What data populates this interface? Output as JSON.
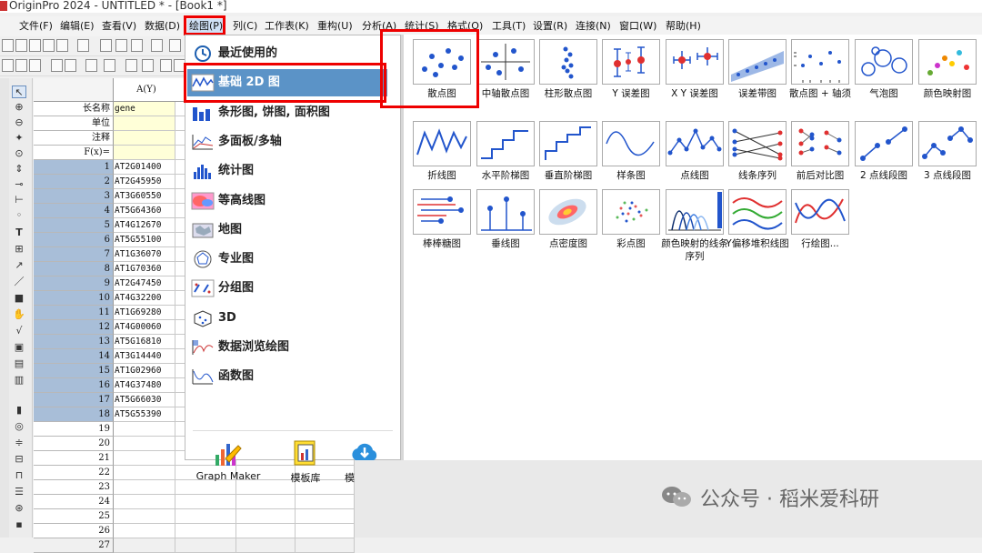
{
  "window": {
    "title": "OriginPro 2024 - UNTITLED * - [Book1 *]"
  },
  "menubar": [
    {
      "label": "文件(F)"
    },
    {
      "label": "编辑(E)"
    },
    {
      "label": "查看(V)"
    },
    {
      "label": "数据(D)"
    },
    {
      "label": "绘图(P)"
    },
    {
      "label": "列(C)"
    },
    {
      "label": "工作表(K)"
    },
    {
      "label": "重构(U)"
    },
    {
      "label": "分析(A)"
    },
    {
      "label": "统计(S)"
    },
    {
      "label": "格式(O)"
    },
    {
      "label": "工具(T)"
    },
    {
      "label": "设置(R)"
    },
    {
      "label": "连接(N)"
    },
    {
      "label": "窗口(W)"
    },
    {
      "label": "帮助(H)"
    }
  ],
  "worksheet": {
    "column_header": "A(Y)",
    "meta_rows": [
      {
        "label": "长名称",
        "value": "gene"
      },
      {
        "label": "单位",
        "value": ""
      },
      {
        "label": "注释",
        "value": ""
      },
      {
        "label": "F(x)=",
        "value": ""
      }
    ],
    "rows": [
      {
        "n": "1",
        "v": "AT2G01400"
      },
      {
        "n": "2",
        "v": "AT2G45950"
      },
      {
        "n": "3",
        "v": "AT3G60550"
      },
      {
        "n": "4",
        "v": "AT5G64360"
      },
      {
        "n": "5",
        "v": "AT4G12670"
      },
      {
        "n": "6",
        "v": "AT5G55100"
      },
      {
        "n": "7",
        "v": "AT1G36070"
      },
      {
        "n": "8",
        "v": "AT1G70360"
      },
      {
        "n": "9",
        "v": "AT2G47450"
      },
      {
        "n": "10",
        "v": "AT4G32200"
      },
      {
        "n": "11",
        "v": "AT1G69280"
      },
      {
        "n": "12",
        "v": "AT4G00060"
      },
      {
        "n": "13",
        "v": "AT5G16810"
      },
      {
        "n": "14",
        "v": "AT3G14440"
      },
      {
        "n": "15",
        "v": "AT1G02960"
      },
      {
        "n": "16",
        "v": "AT4G37480"
      },
      {
        "n": "17",
        "v": "AT5G66030"
      },
      {
        "n": "18",
        "v": "AT5G55390"
      },
      {
        "n": "19",
        "v": ""
      },
      {
        "n": "20",
        "v": ""
      },
      {
        "n": "21",
        "v": ""
      },
      {
        "n": "22",
        "v": ""
      },
      {
        "n": "23",
        "v": ""
      },
      {
        "n": "24",
        "v": ""
      },
      {
        "n": "25",
        "v": ""
      },
      {
        "n": "26",
        "v": ""
      },
      {
        "n": "27",
        "v": ""
      }
    ]
  },
  "plot_menu": {
    "categories": [
      {
        "label": "最近使用的",
        "icon": "clock-icon"
      },
      {
        "label": "基础 2D 图",
        "icon": "line-wave-icon"
      },
      {
        "label": "条形图, 饼图, 面积图",
        "icon": "bar-chart-icon"
      },
      {
        "label": "多面板/多轴",
        "icon": "multi-panel-icon"
      },
      {
        "label": "统计图",
        "icon": "histogram-icon"
      },
      {
        "label": "等高线图",
        "icon": "contour-icon"
      },
      {
        "label": "地图",
        "icon": "map-icon"
      },
      {
        "label": "专业图",
        "icon": "polar-icon"
      },
      {
        "label": "分组图",
        "icon": "grouped-icon"
      },
      {
        "label": "3D",
        "icon": "cube-icon"
      },
      {
        "label": "数据浏览绘图",
        "icon": "data-explore-icon"
      },
      {
        "label": "函数图",
        "icon": "function-icon"
      }
    ],
    "bottom": [
      {
        "label": "Graph Maker",
        "icon": "graph-maker-icon"
      },
      {
        "label": "模板库",
        "icon": "template-library-icon"
      },
      {
        "label": "模板中心",
        "icon": "cloud-download-icon"
      }
    ]
  },
  "gallery": [
    {
      "label": "散点图"
    },
    {
      "label": "中轴散点图"
    },
    {
      "label": "柱形散点图"
    },
    {
      "label": "Y 误差图"
    },
    {
      "label": "X Y 误差图"
    },
    {
      "label": "误差带图"
    },
    {
      "label": "散点图 + 轴须"
    },
    {
      "label": "气泡图"
    },
    {
      "label": "颜色映射图"
    },
    {
      "label": "折线图"
    },
    {
      "label": "水平阶梯图"
    },
    {
      "label": "垂直阶梯图"
    },
    {
      "label": "样条图"
    },
    {
      "label": "点线图"
    },
    {
      "label": "线条序列"
    },
    {
      "label": "前后对比图"
    },
    {
      "label": "2 点线段图"
    },
    {
      "label": "3 点线段图"
    },
    {
      "label": "棒棒糖图"
    },
    {
      "label": "垂线图"
    },
    {
      "label": "点密度图"
    },
    {
      "label": "彩点图"
    },
    {
      "label": "颜色映射的线条序列"
    },
    {
      "label": "Y偏移堆积线图"
    },
    {
      "label": "行绘图..."
    }
  ],
  "watermark": {
    "text": "公众号 · 稻米爱科研"
  },
  "colors": {
    "highlight": "#5b93c7",
    "selected_rows": "#a8bed8",
    "annotation_red": "#e00000",
    "plot_blue": "#2255cc"
  }
}
